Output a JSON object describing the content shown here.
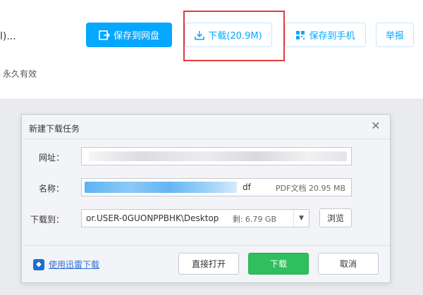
{
  "share_page": {
    "file_title_fragment": "l)...",
    "validity": "永久有效",
    "buttons": {
      "save_to_pan": "保存到网盘",
      "download": "下载(20.9M)",
      "save_to_phone": "保存到手机",
      "report": "举报"
    }
  },
  "dialog": {
    "title": "新建下载任务",
    "labels": {
      "url": "网址：",
      "name": "名称：",
      "dest": "下载到："
    },
    "name_suffix": "df",
    "file_type_size": "PDF文档 20.95 MB",
    "dest_path": "or.USER-0GUONPPBHK\\Desktop",
    "free_space": "剩: 6.79 GB",
    "browse": "浏览",
    "use_thunder": "使用迅雷下载",
    "open_direct": "直接打开",
    "download": "下载",
    "cancel": "取消"
  },
  "colors": {
    "accent_blue": "#06a7ff",
    "download_green": "#2fbf5d",
    "highlight_red": "#e23b3b"
  }
}
